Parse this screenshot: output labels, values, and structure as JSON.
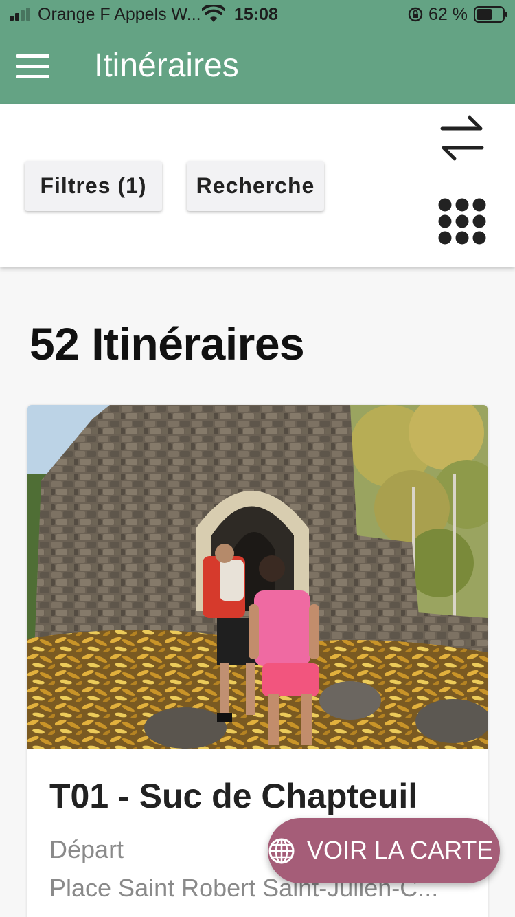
{
  "status_bar": {
    "carrier": "Orange F Appels W...",
    "time": "15:08",
    "battery_percent": "62 %",
    "battery_level": 0.62,
    "icons": [
      "signal-icon",
      "wifi-icon",
      "orientation-lock-icon",
      "battery-icon"
    ]
  },
  "app_bar": {
    "title": "Itinéraires",
    "menu_icon": "hamburger-menu-icon"
  },
  "toolbar": {
    "filters_label": "Filtres (1)",
    "search_label": "Recherche",
    "swap_icon": "swap-arrows-icon",
    "grid_icon": "grid-view-icon"
  },
  "results": {
    "count_title": "52 Itinéraires"
  },
  "cards": [
    {
      "title": "T01 - Suc de Chapteuil",
      "departure_label": "Départ",
      "departure_place": "Place Saint Robert Saint-Julien-C..."
    }
  ],
  "map_button": {
    "label": "VOIR LA CARTE",
    "icon": "globe-icon"
  },
  "colors": {
    "header_green": "#64a384",
    "fab_mauve": "#a55d78",
    "toolbar_bg": "#ffffff",
    "page_bg": "#f7f7f7"
  }
}
